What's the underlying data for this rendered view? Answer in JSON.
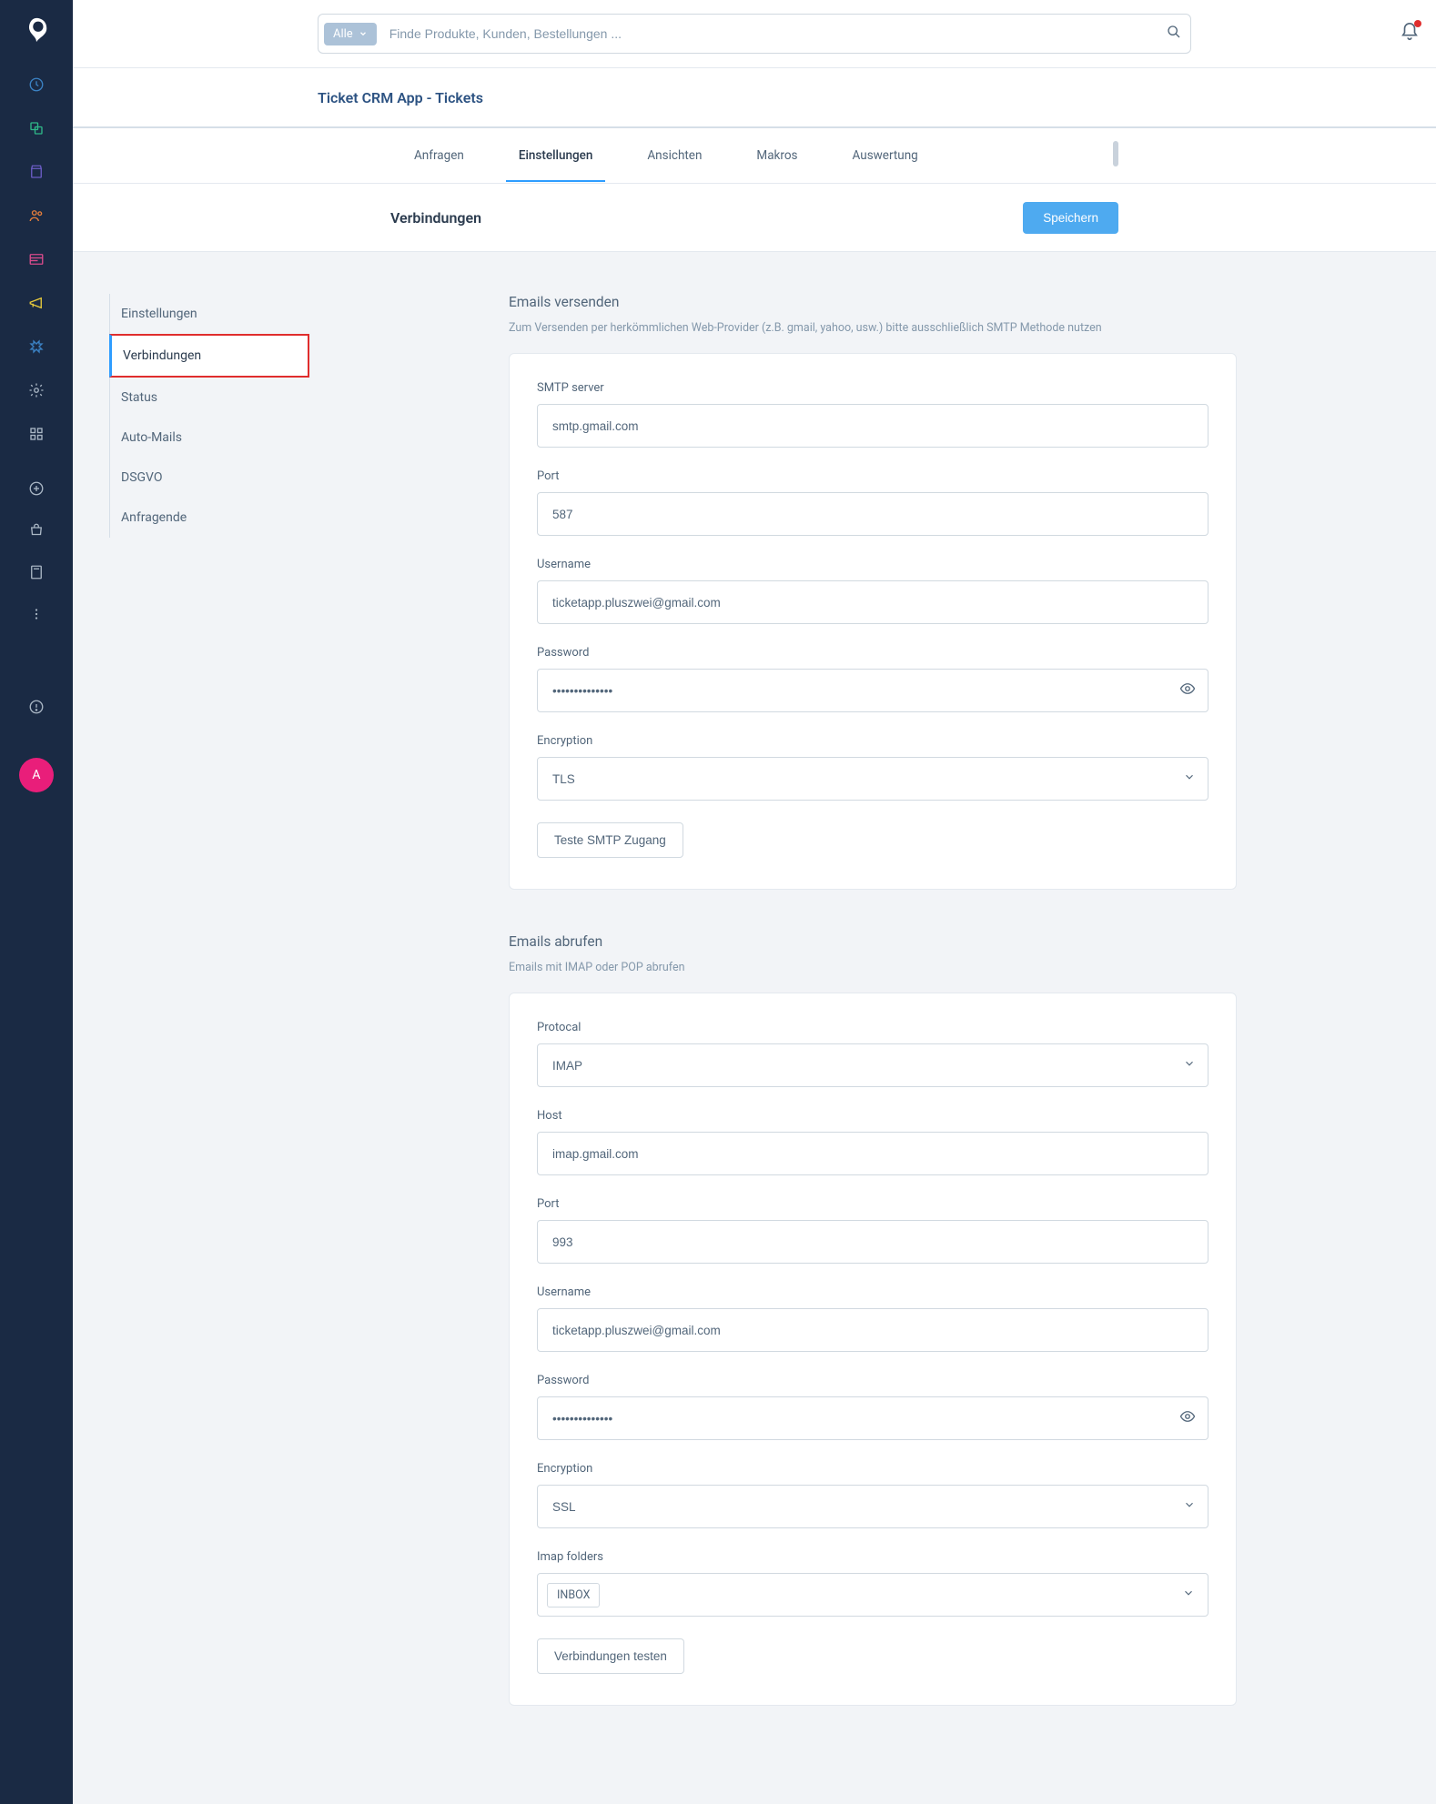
{
  "search": {
    "select_label": "Alle",
    "placeholder": "Finde Produkte, Kunden, Bestellungen ..."
  },
  "page": {
    "title": "Ticket CRM App - Tickets"
  },
  "tabs": [
    {
      "label": "Anfragen",
      "active": false
    },
    {
      "label": "Einstellungen",
      "active": true
    },
    {
      "label": "Ansichten",
      "active": false
    },
    {
      "label": "Makros",
      "active": false
    },
    {
      "label": "Auswertung",
      "active": false
    }
  ],
  "section": {
    "title": "Verbindungen",
    "save_label": "Speichern"
  },
  "side_menu": [
    {
      "label": "Einstellungen",
      "selected": false
    },
    {
      "label": "Verbindungen",
      "selected": true
    },
    {
      "label": "Status",
      "selected": false
    },
    {
      "label": "Auto-Mails",
      "selected": false
    },
    {
      "label": "DSGVO",
      "selected": false
    },
    {
      "label": "Anfragende",
      "selected": false
    }
  ],
  "send": {
    "title": "Emails versenden",
    "sub": "Zum Versenden per herkömmlichen Web-Provider (z.B. gmail, yahoo, usw.) bitte ausschließlich SMTP Methode nutzen",
    "server_label": "SMTP server",
    "server_value": "smtp.gmail.com",
    "port_label": "Port",
    "port_value": "587",
    "user_label": "Username",
    "user_value": "ticketapp.pluszwei@gmail.com",
    "pass_label": "Password",
    "pass_value": "••••••••••••••",
    "enc_label": "Encryption",
    "enc_value": "TLS",
    "test_label": "Teste SMTP Zugang"
  },
  "recv": {
    "title": "Emails abrufen",
    "sub": "Emails mit IMAP oder POP abrufen",
    "proto_label": "Protocal",
    "proto_value": "IMAP",
    "host_label": "Host",
    "host_value": "imap.gmail.com",
    "port_label": "Port",
    "port_value": "993",
    "user_label": "Username",
    "user_value": "ticketapp.pluszwei@gmail.com",
    "pass_label": "Password",
    "pass_value": "••••••••••••••",
    "enc_label": "Encryption",
    "enc_value": "SSL",
    "folders_label": "Imap folders",
    "folders_tag": "INBOX",
    "test_label": "Verbindungen testen"
  },
  "avatar": "A"
}
